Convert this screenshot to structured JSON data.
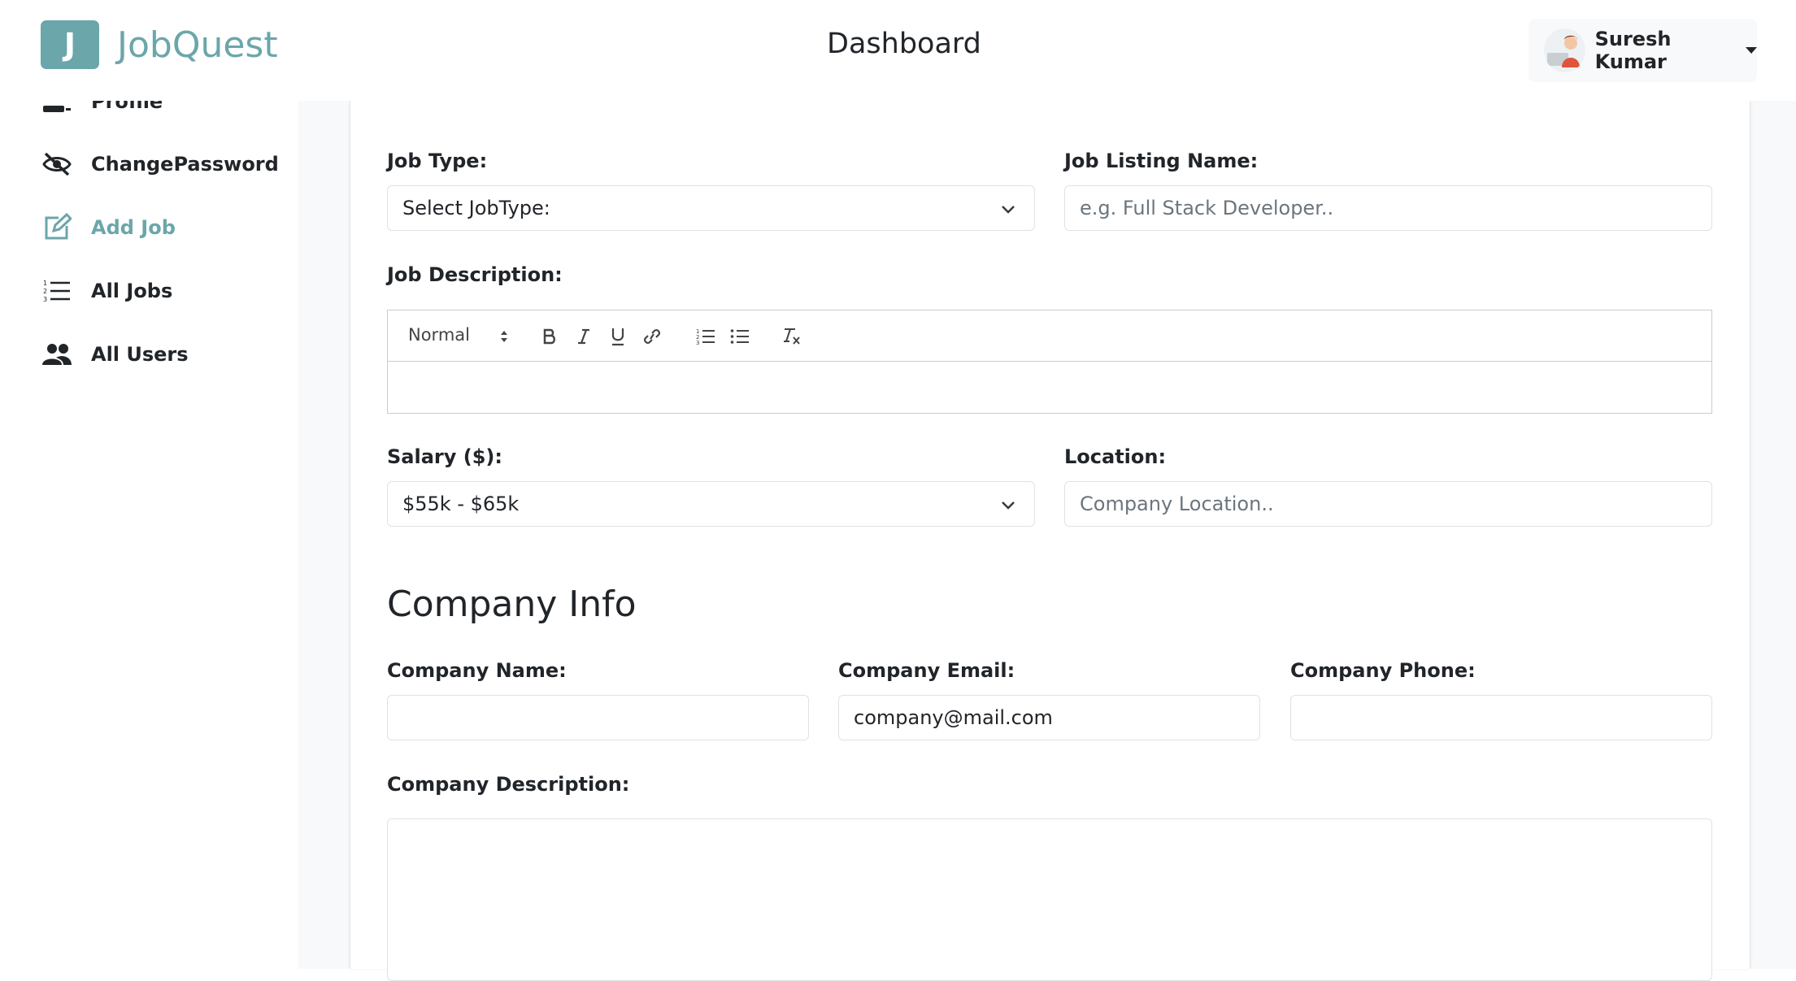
{
  "app": {
    "logo_letter": "J",
    "name": "JobQuest"
  },
  "header": {
    "title": "Dashboard",
    "user_name": "Suresh Kumar"
  },
  "sidebar": {
    "items": [
      {
        "label": "Profile",
        "icon": "id-card-icon"
      },
      {
        "label": "ChangePassword",
        "icon": "eye-slash-icon"
      },
      {
        "label": "Add Job",
        "icon": "edit-icon",
        "active": true
      },
      {
        "label": "All Jobs",
        "icon": "list-icon"
      },
      {
        "label": "All Users",
        "icon": "users-icon"
      }
    ]
  },
  "form": {
    "job_type": {
      "label": "Job Type:",
      "value": "Select JobType:"
    },
    "job_listing_name": {
      "label": "Job Listing Name:",
      "placeholder": "e.g. Full Stack Developer.."
    },
    "job_description": {
      "label": "Job Description:",
      "heading_option": "Normal"
    },
    "salary": {
      "label": "Salary ($):",
      "value": "$55k - $65k"
    },
    "location": {
      "label": "Location:",
      "placeholder": "Company Location.."
    },
    "company_section_title": "Company Info",
    "company_name": {
      "label": "Company Name:",
      "value": ""
    },
    "company_email": {
      "label": "Company Email:",
      "value": "company@mail.com"
    },
    "company_phone": {
      "label": "Company Phone:",
      "value": ""
    },
    "company_description": {
      "label": "Company Description:"
    }
  },
  "colors": {
    "accent": "#6ba6aa",
    "sidebar_bg": "#ffffff",
    "main_bg": "#f8f9fa",
    "text": "#212529"
  }
}
